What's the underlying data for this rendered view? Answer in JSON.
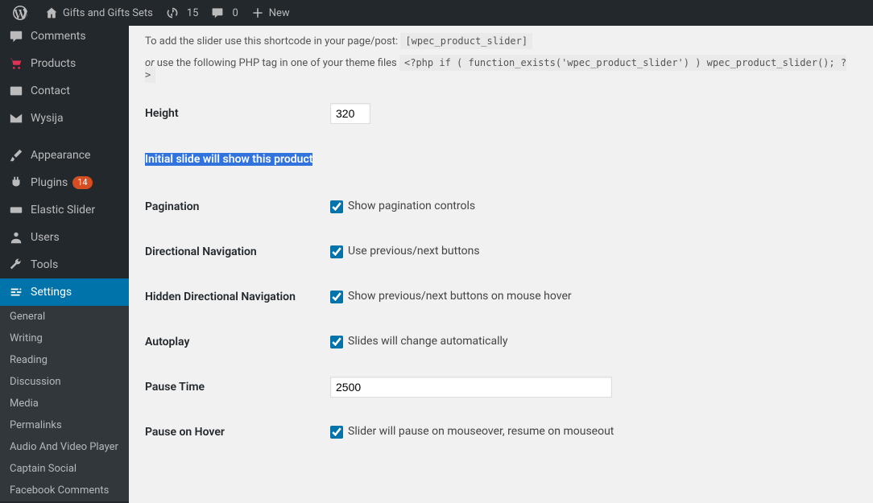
{
  "adminbar": {
    "site_title": "Gifts and Gifts Sets",
    "updates_count": "15",
    "comments_count": "0",
    "new_label": "New"
  },
  "sidebar": {
    "items": [
      {
        "label": "Comments",
        "icon": "comments"
      },
      {
        "label": "Products",
        "icon": "cart"
      },
      {
        "label": "Contact",
        "icon": "id"
      },
      {
        "label": "Wysija",
        "icon": "mail"
      },
      {
        "label": "Appearance",
        "icon": "brush"
      },
      {
        "label": "Plugins",
        "icon": "plug",
        "badge": "14"
      },
      {
        "label": "Elastic Slider",
        "icon": "slider"
      },
      {
        "label": "Users",
        "icon": "user"
      },
      {
        "label": "Tools",
        "icon": "wrench"
      },
      {
        "label": "Settings",
        "icon": "gear",
        "active": true
      }
    ],
    "submenu": [
      "General",
      "Writing",
      "Reading",
      "Discussion",
      "Media",
      "Permalinks",
      "Audio And Video Player",
      "Captain Social",
      "Facebook Comments"
    ]
  },
  "notes": {
    "shortcode_prefix": "To add the slider use this shortcode in your page/post: ",
    "shortcode": "[wpec_product_slider]",
    "or": "or",
    "php_prefix": " use the following PHP tag in one of your theme files ",
    "php_code": "<?php if ( function_exists('wpec_product_slider') ) wpec_product_slider(); ?>"
  },
  "form": {
    "height": {
      "label": "Height",
      "value": "320"
    },
    "initial": {
      "label": "Initial slide will show this product"
    },
    "pagination": {
      "label": "Pagination",
      "desc": "Show pagination controls"
    },
    "dirnav": {
      "label": "Directional Navigation",
      "desc": "Use previous/next buttons"
    },
    "hidden_dirnav": {
      "label": "Hidden Directional Navigation",
      "desc": "Show previous/next buttons on mouse hover"
    },
    "autoplay": {
      "label": "Autoplay",
      "desc": "Slides will change automatically"
    },
    "pause_time": {
      "label": "Pause Time",
      "value": "2500"
    },
    "pause_hover": {
      "label": "Pause on Hover",
      "desc": "Slider will pause on mouseover, resume on mouseout"
    }
  }
}
